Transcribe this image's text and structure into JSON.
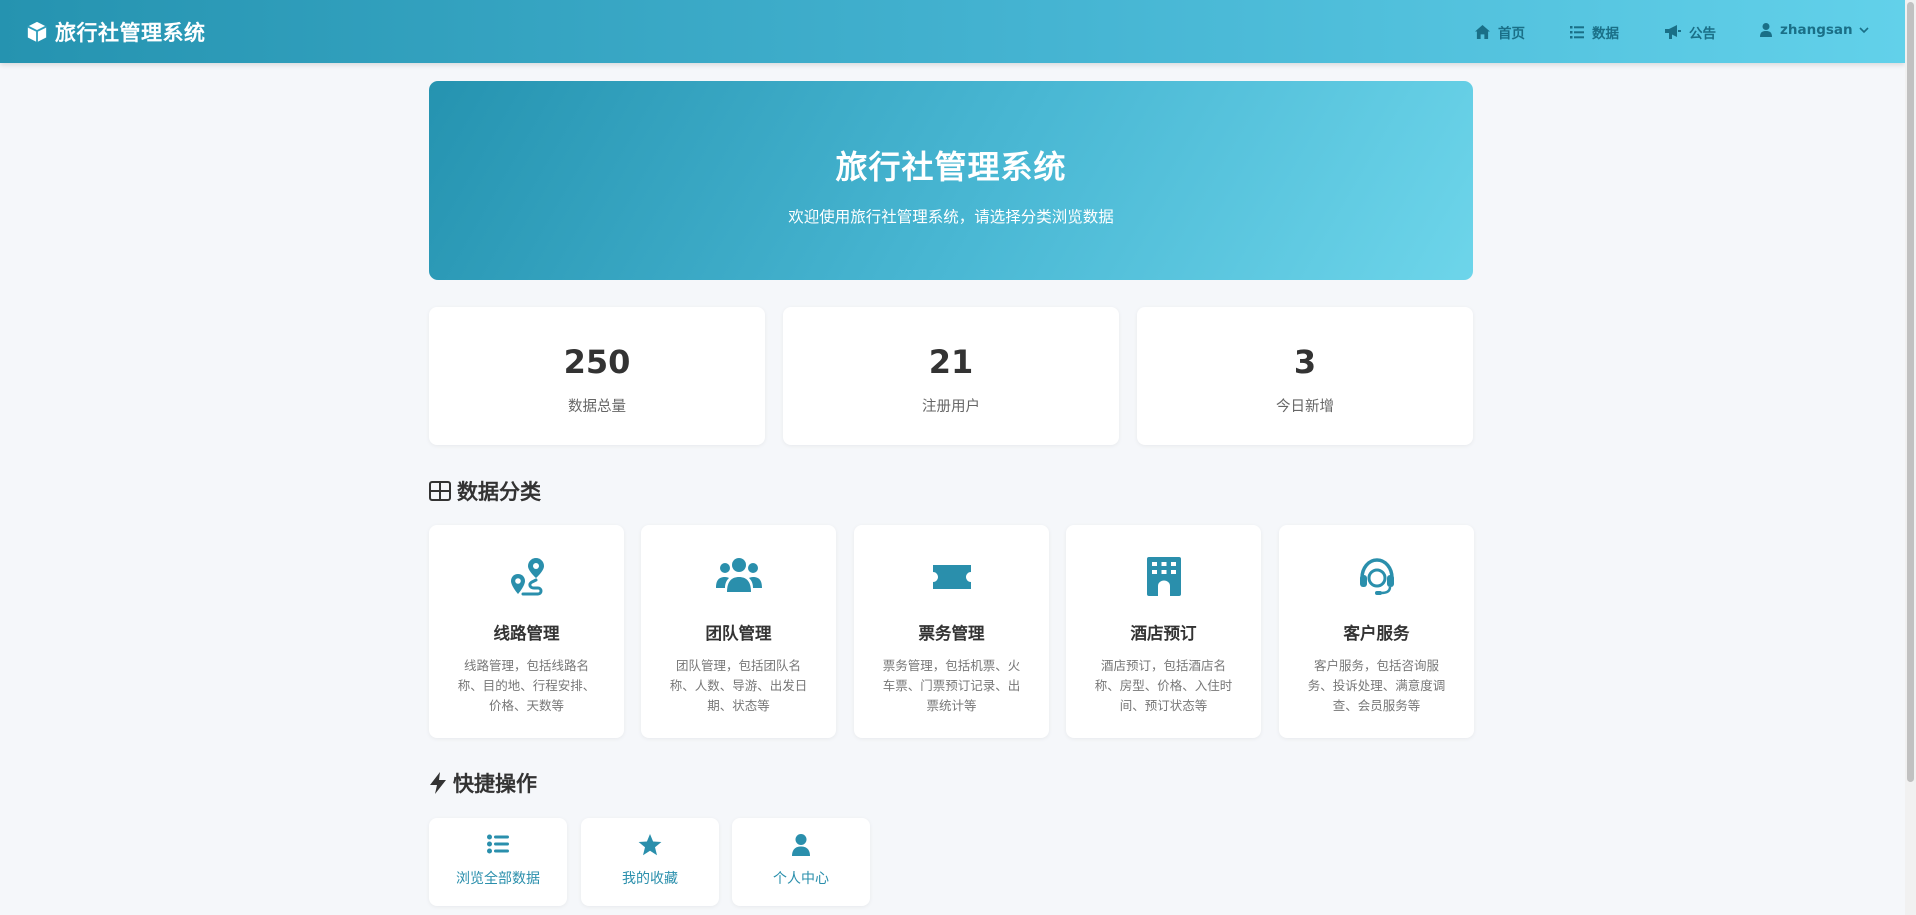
{
  "navbar": {
    "brand": "旅行社管理系统",
    "home": "首页",
    "data": "数据",
    "notice": "公告",
    "user": "zhangsan"
  },
  "hero": {
    "title": "旅行社管理系统",
    "subtitle": "欢迎使用旅行社管理系统，请选择分类浏览数据"
  },
  "stats": [
    {
      "value": "250",
      "label": "数据总量"
    },
    {
      "value": "21",
      "label": "注册用户"
    },
    {
      "value": "3",
      "label": "今日新增"
    }
  ],
  "categories_title": "数据分类",
  "categories": [
    {
      "icon": "route-icon",
      "title": "线路管理",
      "desc": "线路管理，包括线路名称、目的地、行程安排、价格、天数等"
    },
    {
      "icon": "users-icon",
      "title": "团队管理",
      "desc": "团队管理，包括团队名称、人数、导游、出发日期、状态等"
    },
    {
      "icon": "ticket-icon",
      "title": "票务管理",
      "desc": "票务管理，包括机票、火车票、门票预订记录、出票统计等"
    },
    {
      "icon": "hotel-icon",
      "title": "酒店预订",
      "desc": "酒店预订，包括酒店名称、房型、价格、入住时间、预订状态等"
    },
    {
      "icon": "headset-icon",
      "title": "客户服务",
      "desc": "客户服务，包括咨询服务、投诉处理、满意度调查、会员服务等"
    }
  ],
  "quick_title": "快捷操作",
  "quick_actions": [
    {
      "icon": "list-icon",
      "label": "浏览全部数据"
    },
    {
      "icon": "star-icon",
      "label": "我的收藏"
    },
    {
      "icon": "user-icon",
      "label": "个人中心"
    }
  ],
  "colors": {
    "primary": "#2593b0",
    "gradient_end": "#6dd5ea",
    "background": "#f5f7fa"
  }
}
